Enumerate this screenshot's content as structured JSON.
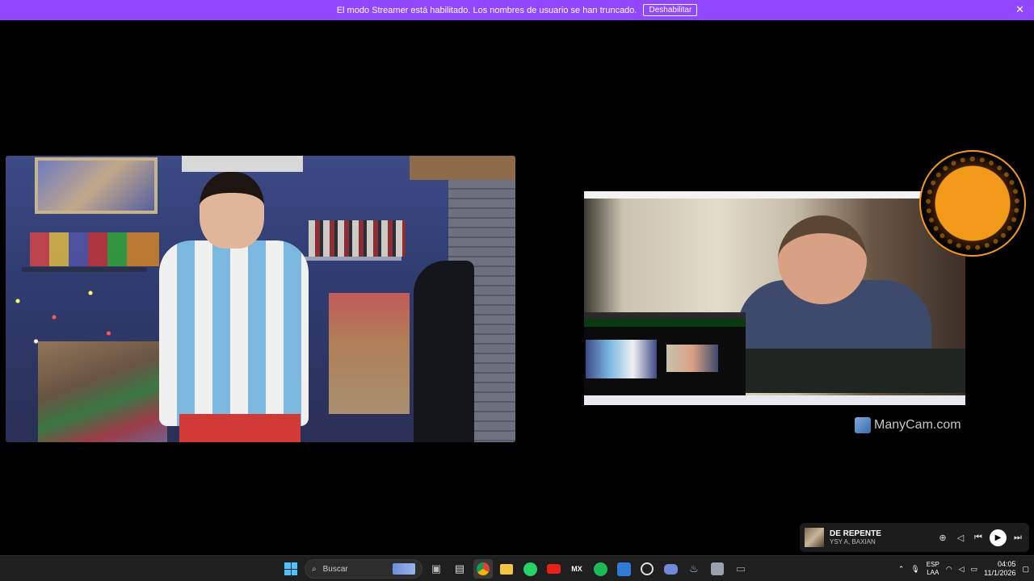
{
  "banner": {
    "message": "El modo Streamer está habilitado. Los nombres de usuario se han truncado.",
    "button_label": "Deshabilitar",
    "close_glyph": "✕",
    "color": "#9147ff"
  },
  "overlay": {
    "watermark": "ManyCam.com"
  },
  "media_player": {
    "title": "DE REPENTE",
    "artist": "YSY A, BAXIAN",
    "icons": [
      "add-icon",
      "volume-icon",
      "previous-icon",
      "play-icon",
      "next-icon"
    ]
  },
  "taskbar": {
    "search_placeholder": "Buscar",
    "apps": [
      "start",
      "search",
      "task-view",
      "store",
      "chrome",
      "file-explorer",
      "whatsapp",
      "youtube",
      "mx",
      "spotify",
      "app-blue",
      "github",
      "discord",
      "steam",
      "app-gray",
      "app-misc"
    ],
    "language_line1": "ESP",
    "language_line2": "LAA",
    "time": "04:05",
    "date": "11/1/2026"
  }
}
